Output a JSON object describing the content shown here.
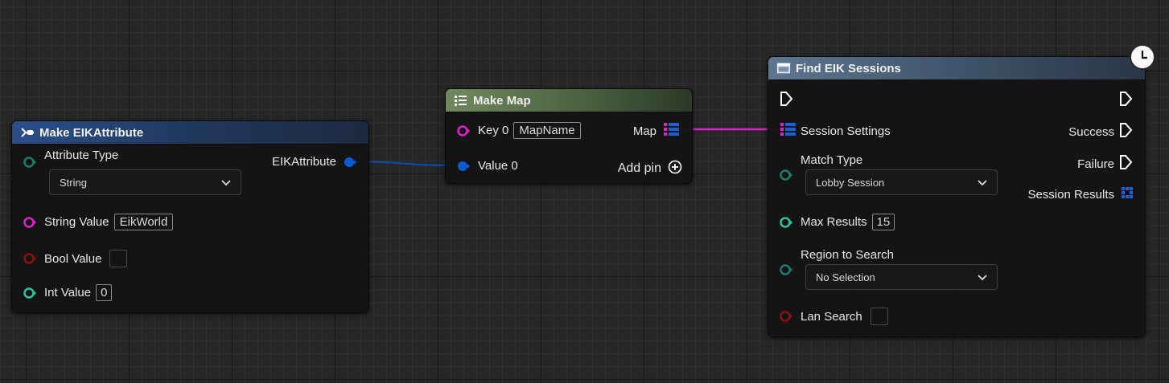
{
  "nodes": {
    "make_eik_attribute": {
      "title": "Make EIKAttribute",
      "attribute_type_label": "Attribute Type",
      "attribute_type_value": "String",
      "output_label": "EIKAttribute",
      "string_value_label": "String Value",
      "string_value": "EikWorld",
      "bool_value_label": "Bool Value",
      "int_value_label": "Int Value",
      "int_value": "0"
    },
    "make_map": {
      "title": "Make Map",
      "key_label": "Key 0",
      "key_value": "MapName",
      "value_label": "Value 0",
      "map_label": "Map",
      "add_pin_label": "Add pin"
    },
    "find_eik_sessions": {
      "title": "Find EIK Sessions",
      "session_settings_label": "Session Settings",
      "success_label": "Success",
      "match_type_label": "Match Type",
      "match_type_value": "Lobby Session",
      "failure_label": "Failure",
      "session_results_label": "Session Results",
      "max_results_label": "Max Results",
      "max_results_value": "15",
      "region_label": "Region to Search",
      "region_value": "No Selection",
      "lan_search_label": "Lan Search"
    }
  },
  "colors": {
    "struct_pin": "#0a5bd2",
    "string_pin": "#e01fd0",
    "bool_pin": "#8c1212",
    "int_pin": "#2cc4a0",
    "byte_pin": "#1f7a6c",
    "map_key": "#e01fd0",
    "map_value": "#1d5fd6"
  }
}
